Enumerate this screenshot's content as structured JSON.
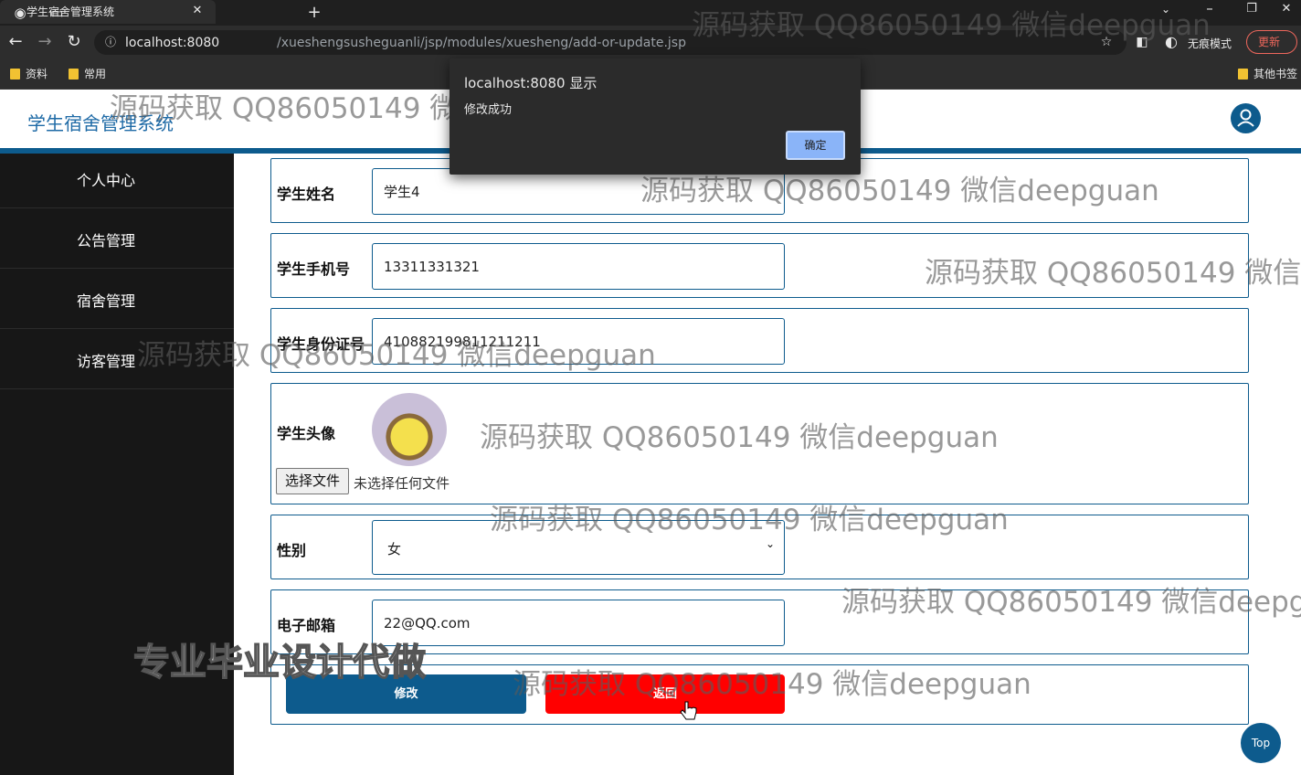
{
  "browser": {
    "tab_title": "学生宿舍管理系统",
    "url_host": "localhost:8080",
    "url_path": "/xueshengsusheguanli/jsp/modules/xuesheng/add-or-update.jsp",
    "incognito_label": "无痕模式",
    "update_label": "更新",
    "bookmarks": [
      "资料",
      "常用"
    ],
    "other_bookmarks": "其他书签"
  },
  "header": {
    "brand": "学生宿舍管理系统"
  },
  "sidebar": {
    "items": [
      {
        "label": "个人中心"
      },
      {
        "label": "公告管理"
      },
      {
        "label": "宿舍管理"
      },
      {
        "label": "访客管理"
      }
    ]
  },
  "form": {
    "name": {
      "label": "学生姓名",
      "value": "学生4"
    },
    "phone": {
      "label": "学生手机号",
      "value": "13311331321"
    },
    "id_card": {
      "label": "学生身份证号",
      "value": "410882199811211211"
    },
    "avatar": {
      "label": "学生头像",
      "file_button": "选择文件",
      "file_status": "未选择任何文件"
    },
    "gender": {
      "label": "性别",
      "value": "女"
    },
    "email": {
      "label": "电子邮箱",
      "value": "22@QQ.com"
    },
    "submit_label": "修改",
    "back_label": "返回"
  },
  "dialog": {
    "title": "localhost:8080 显示",
    "message": "修改成功",
    "ok_label": "确定"
  },
  "watermark": {
    "text": "源码获取 QQ86050149 微信deepguan",
    "promo": "专业毕业设计代做"
  },
  "top_label": "Top",
  "colors": {
    "primary": "#0d5b8d",
    "sidebar_bg": "#171717",
    "back_button": "#ff0000",
    "brand_text": "#1e6aa6"
  }
}
